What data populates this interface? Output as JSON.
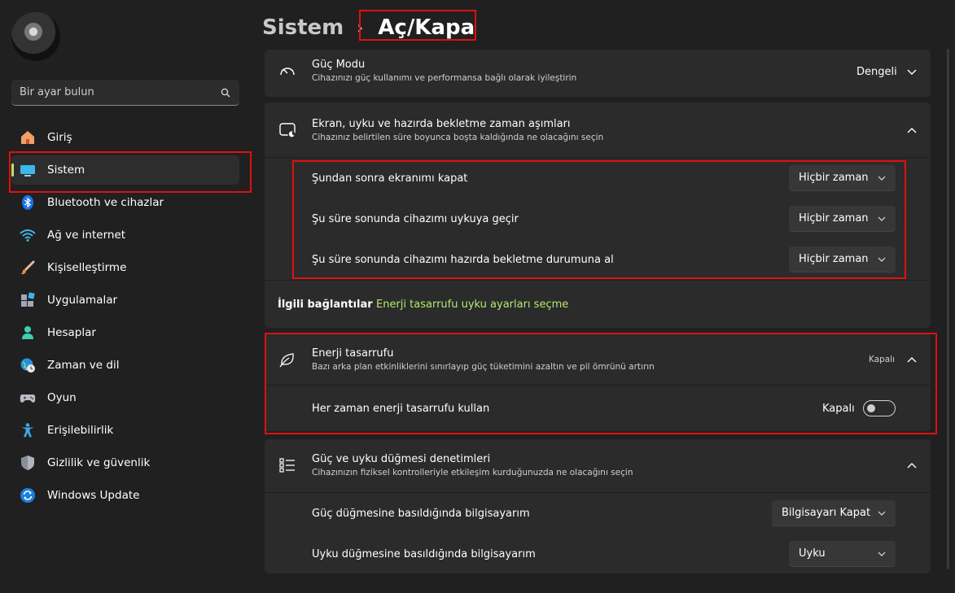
{
  "breadcrumb": {
    "parent": "Sistem",
    "separator": "›",
    "current": "Aç/Kapa"
  },
  "search": {
    "placeholder": "Bir ayar bulun"
  },
  "sidebar": {
    "items": [
      {
        "label": "Giriş",
        "icon": "home-icon"
      },
      {
        "label": "Sistem",
        "icon": "monitor-icon",
        "active": true
      },
      {
        "label": "Bluetooth ve cihazlar",
        "icon": "bluetooth-icon"
      },
      {
        "label": "Ağ ve internet",
        "icon": "wifi-icon"
      },
      {
        "label": "Kişiselleştirme",
        "icon": "brush-icon"
      },
      {
        "label": "Uygulamalar",
        "icon": "apps-icon"
      },
      {
        "label": "Hesaplar",
        "icon": "user-icon"
      },
      {
        "label": "Zaman ve dil",
        "icon": "globe-clock-icon"
      },
      {
        "label": "Oyun",
        "icon": "gamepad-icon"
      },
      {
        "label": "Erişilebilirlik",
        "icon": "accessibility-icon"
      },
      {
        "label": "Gizlilik ve güvenlik",
        "icon": "shield-icon"
      },
      {
        "label": "Windows Update",
        "icon": "update-icon"
      }
    ]
  },
  "power_mode": {
    "title": "Güç Modu",
    "subtitle": "Cihazınızı güç kullanımı ve performansa bağlı olarak iyileştirin",
    "value": "Dengeli"
  },
  "screen_sleep": {
    "title": "Ekran, uyku ve hazırda bekletme zaman aşımları",
    "subtitle": "Cihazınız belirtilen süre boyunca boşta kaldığında ne olacağını seçin",
    "rows": [
      {
        "label": "Şundan sonra ekranımı kapat",
        "value": "Hiçbir zaman"
      },
      {
        "label": "Şu süre sonunda cihazımı uykuya geçir",
        "value": "Hiçbir zaman"
      },
      {
        "label": "Şu süre sonunda cihazımı hazırda bekletme durumuna al",
        "value": "Hiçbir zaman"
      }
    ]
  },
  "related": {
    "label": "İlgili bağlantılar",
    "link": "Enerji tasarrufu uyku ayarları seçme"
  },
  "energy_saver": {
    "title": "Enerji tasarrufu",
    "subtitle": "Bazı arka plan etkinliklerini sınırlayıp güç tüketimini azaltın ve pil ömrünü artırın",
    "status": "Kapalı",
    "always_label": "Her zaman enerji tasarrufu kullan",
    "toggle_label": "Kapalı",
    "toggle_on": false
  },
  "power_buttons": {
    "title": "Güç ve uyku düğmesi denetimleri",
    "subtitle": "Cihazınızın fiziksel kontrolleriyle etkileşim kurduğunuzda ne olacağını seçin",
    "rows": [
      {
        "label": "Güç düğmesine basıldığında bilgisayarım",
        "value": "Bilgisayarı Kapat"
      },
      {
        "label": "Uyku düğmesine basıldığında bilgisayarım",
        "value": "Uyku"
      }
    ]
  },
  "colors": {
    "accent": "#b4e86f",
    "highlight": "#e01010",
    "background": "#202020",
    "card": "#2b2b2b"
  }
}
